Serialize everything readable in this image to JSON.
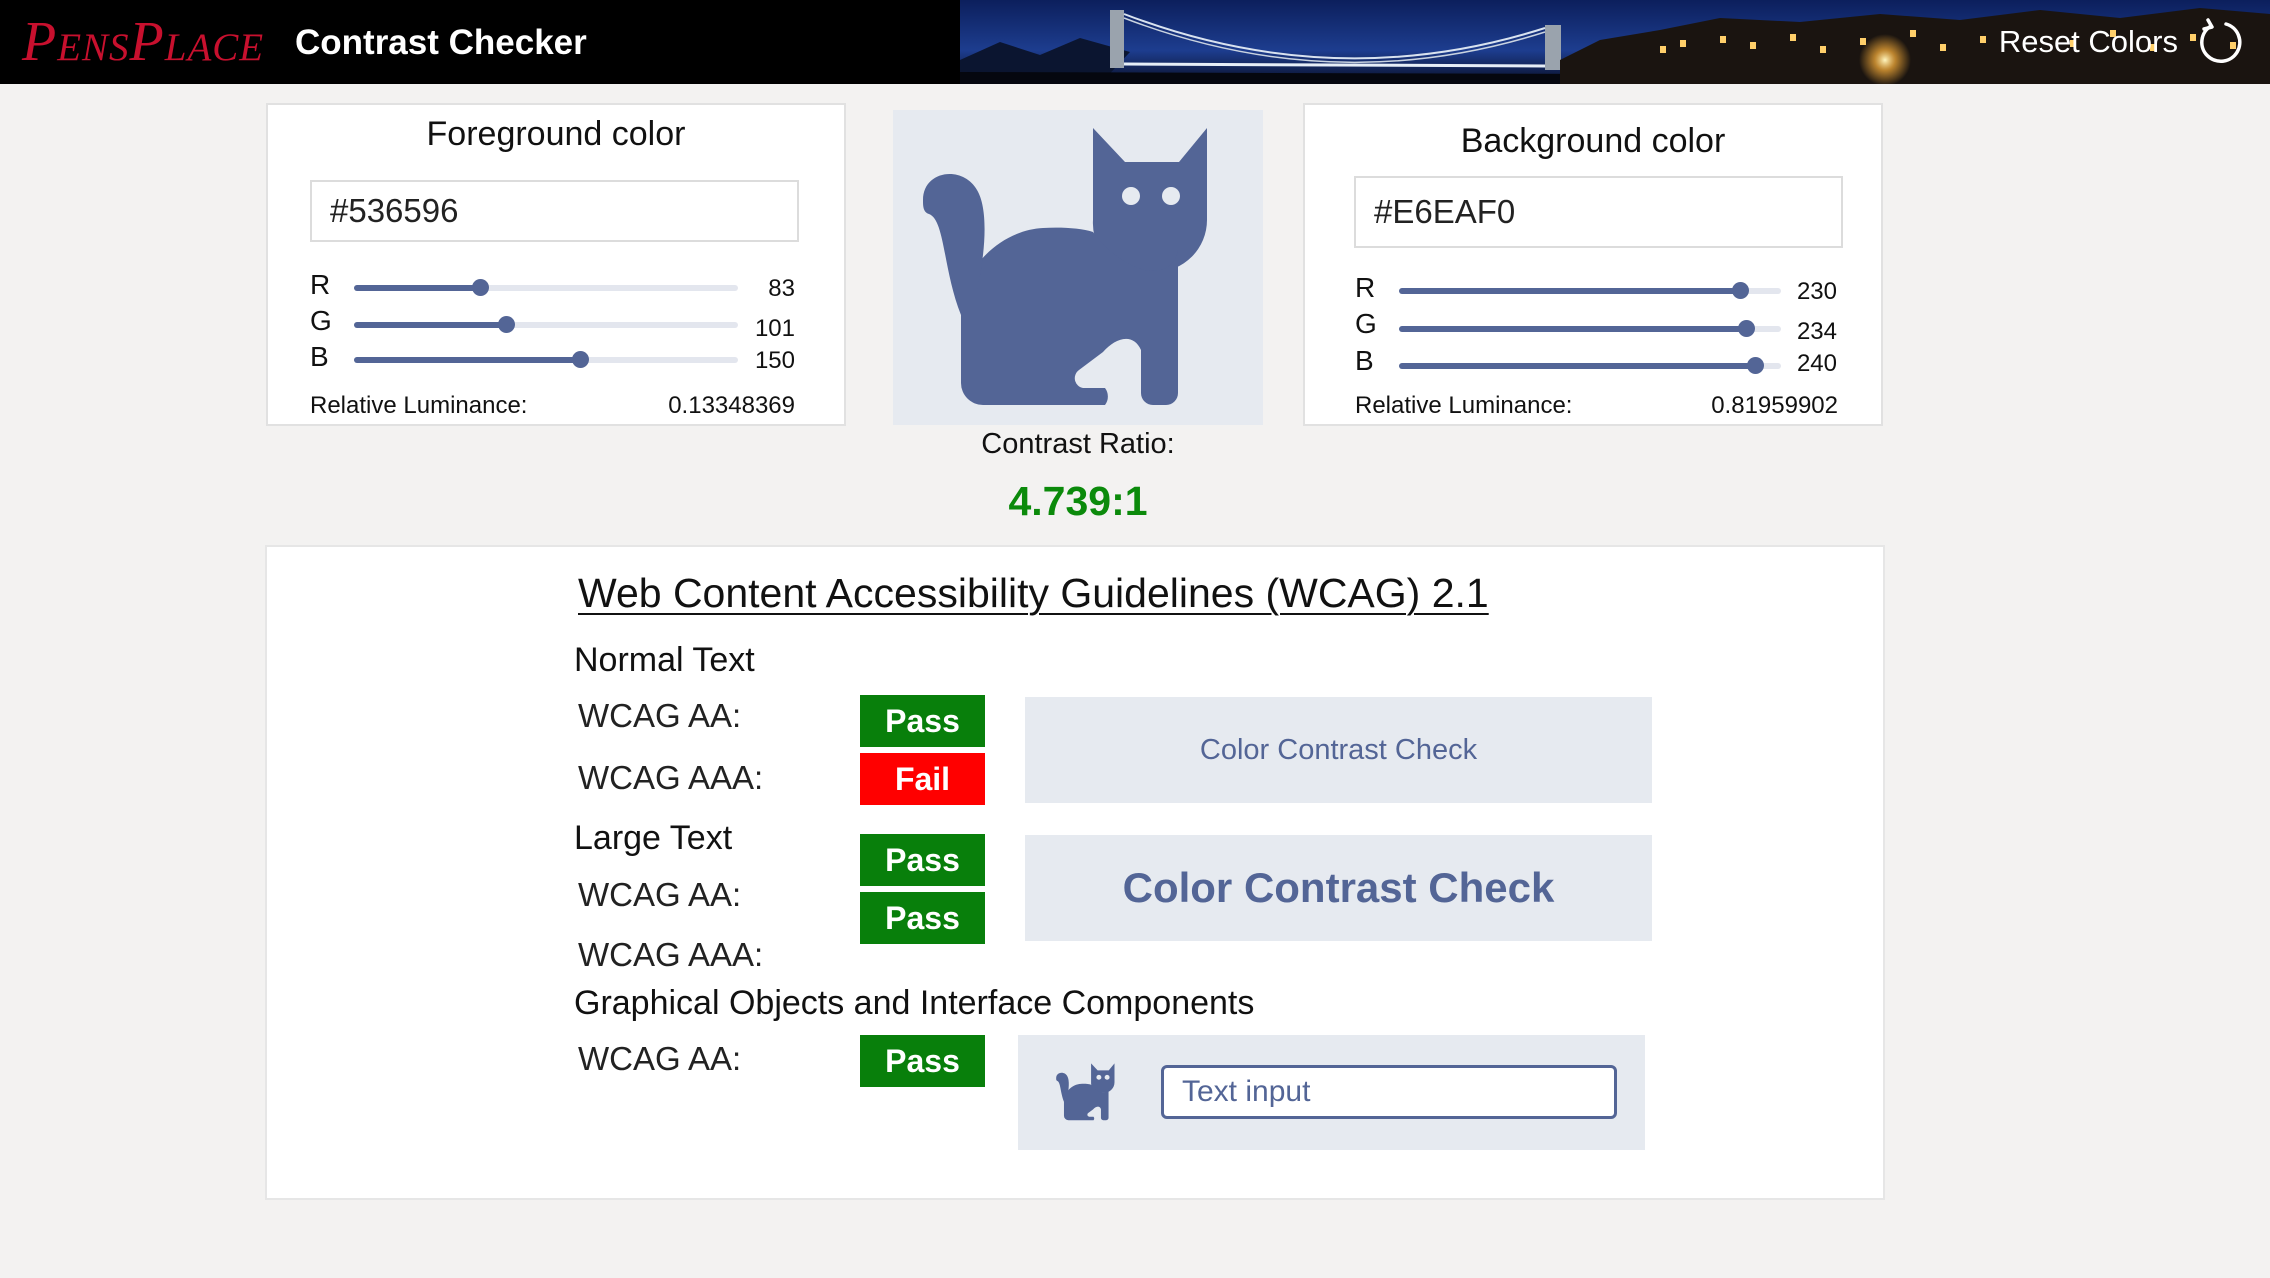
{
  "header": {
    "logo_text": "PensPlace",
    "app_title": "Contrast Checker",
    "reset_label": "Reset Colors",
    "reset_icon": "refresh-icon"
  },
  "foreground": {
    "title": "Foreground color",
    "hex": "#536596",
    "channels": [
      {
        "letter": "R",
        "value": "83"
      },
      {
        "letter": "G",
        "value": "101"
      },
      {
        "letter": "B",
        "value": "150"
      }
    ],
    "luminance_label": "Relative Luminance:",
    "luminance_value": "0.13348369"
  },
  "background": {
    "title": "Background color",
    "hex": "#E6EAF0",
    "channels": [
      {
        "letter": "R",
        "value": "230"
      },
      {
        "letter": "G",
        "value": "234"
      },
      {
        "letter": "B",
        "value": "240"
      }
    ],
    "luminance_label": "Relative Luminance:",
    "luminance_value": "0.81959902"
  },
  "preview": {
    "icon": "cat-icon"
  },
  "contrast": {
    "label": "Contrast Ratio:",
    "value": "4.739:1",
    "value_color": "#0b8a0b"
  },
  "wcag": {
    "title": "Web Content Accessibility Guidelines (WCAG) 2.1",
    "normal": {
      "heading": "Normal Text",
      "aa_label": "WCAG AA:",
      "aa_result": "Pass",
      "aaa_label": "WCAG AAA:",
      "aaa_result": "Fail",
      "sample_text": "Color Contrast Check"
    },
    "large": {
      "heading": "Large Text",
      "aa_label": "WCAG AA:",
      "aa_result": "Pass",
      "aaa_label": "WCAG AAA:",
      "aaa_result": "Pass",
      "sample_text": "Color Contrast Check"
    },
    "objects": {
      "heading": "Graphical Objects and Interface Components",
      "aa_label": "WCAG AA:",
      "aa_result": "Pass",
      "input_placeholder": "Text input"
    }
  },
  "colors": {
    "foreground": "#536596",
    "background": "#E6EAF0",
    "pass": "#087f0b",
    "fail": "#ff0000",
    "logo": "#c8102e"
  }
}
